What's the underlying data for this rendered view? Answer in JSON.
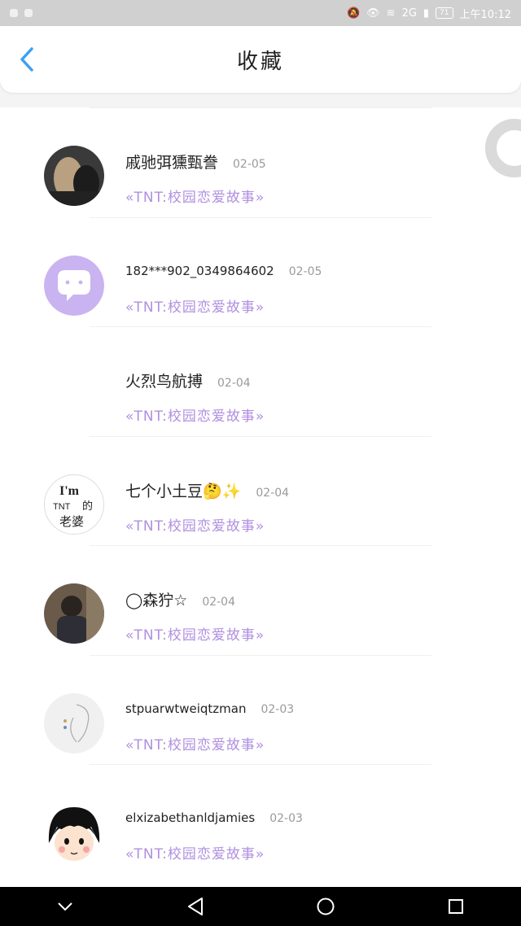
{
  "status": {
    "time": "上午10:12",
    "network": "2G",
    "battery": "71"
  },
  "header": {
    "title": "收藏",
    "back_icon": "chevron-left-icon",
    "accent": "#3ea0f0"
  },
  "items": [
    {
      "name": "戚驰弭獯甄誊",
      "date": "02-05",
      "work": "«TNT:校园恋爱故事»",
      "avatar": "photo-avatar-dark"
    },
    {
      "name": "182***902_0349864602",
      "date": "02-05",
      "work": "«TNT:校园恋爱故事»",
      "avatar": "default-chat-avatar"
    },
    {
      "name": "火烈鸟航搏",
      "date": "02-04",
      "work": "«TNT:校园恋爱故事»",
      "avatar": "empty-avatar"
    },
    {
      "name": "七个小土豆🤔✨",
      "date": "02-04",
      "work": "«TNT:校园恋爱故事»",
      "avatar": "text-avatar",
      "avatar_text": "I'm TNT 的 老婆"
    },
    {
      "name": "◯森狞☆",
      "date": "02-04",
      "work": "«TNT:校园恋爱故事»",
      "avatar": "photo-avatar-person"
    },
    {
      "name": "stpuarwtweiqtzman",
      "date": "02-03",
      "work": "«TNT:校园恋爱故事»",
      "avatar": "sketch-avatar"
    },
    {
      "name": "elxizabethanldjamies",
      "date": "02-03",
      "work": "«TNT:校园恋爱故事»",
      "avatar": "cartoon-avatar"
    }
  ],
  "colors": {
    "work_link": "#b08fe0",
    "default_avatar": "#c9b3f0"
  }
}
